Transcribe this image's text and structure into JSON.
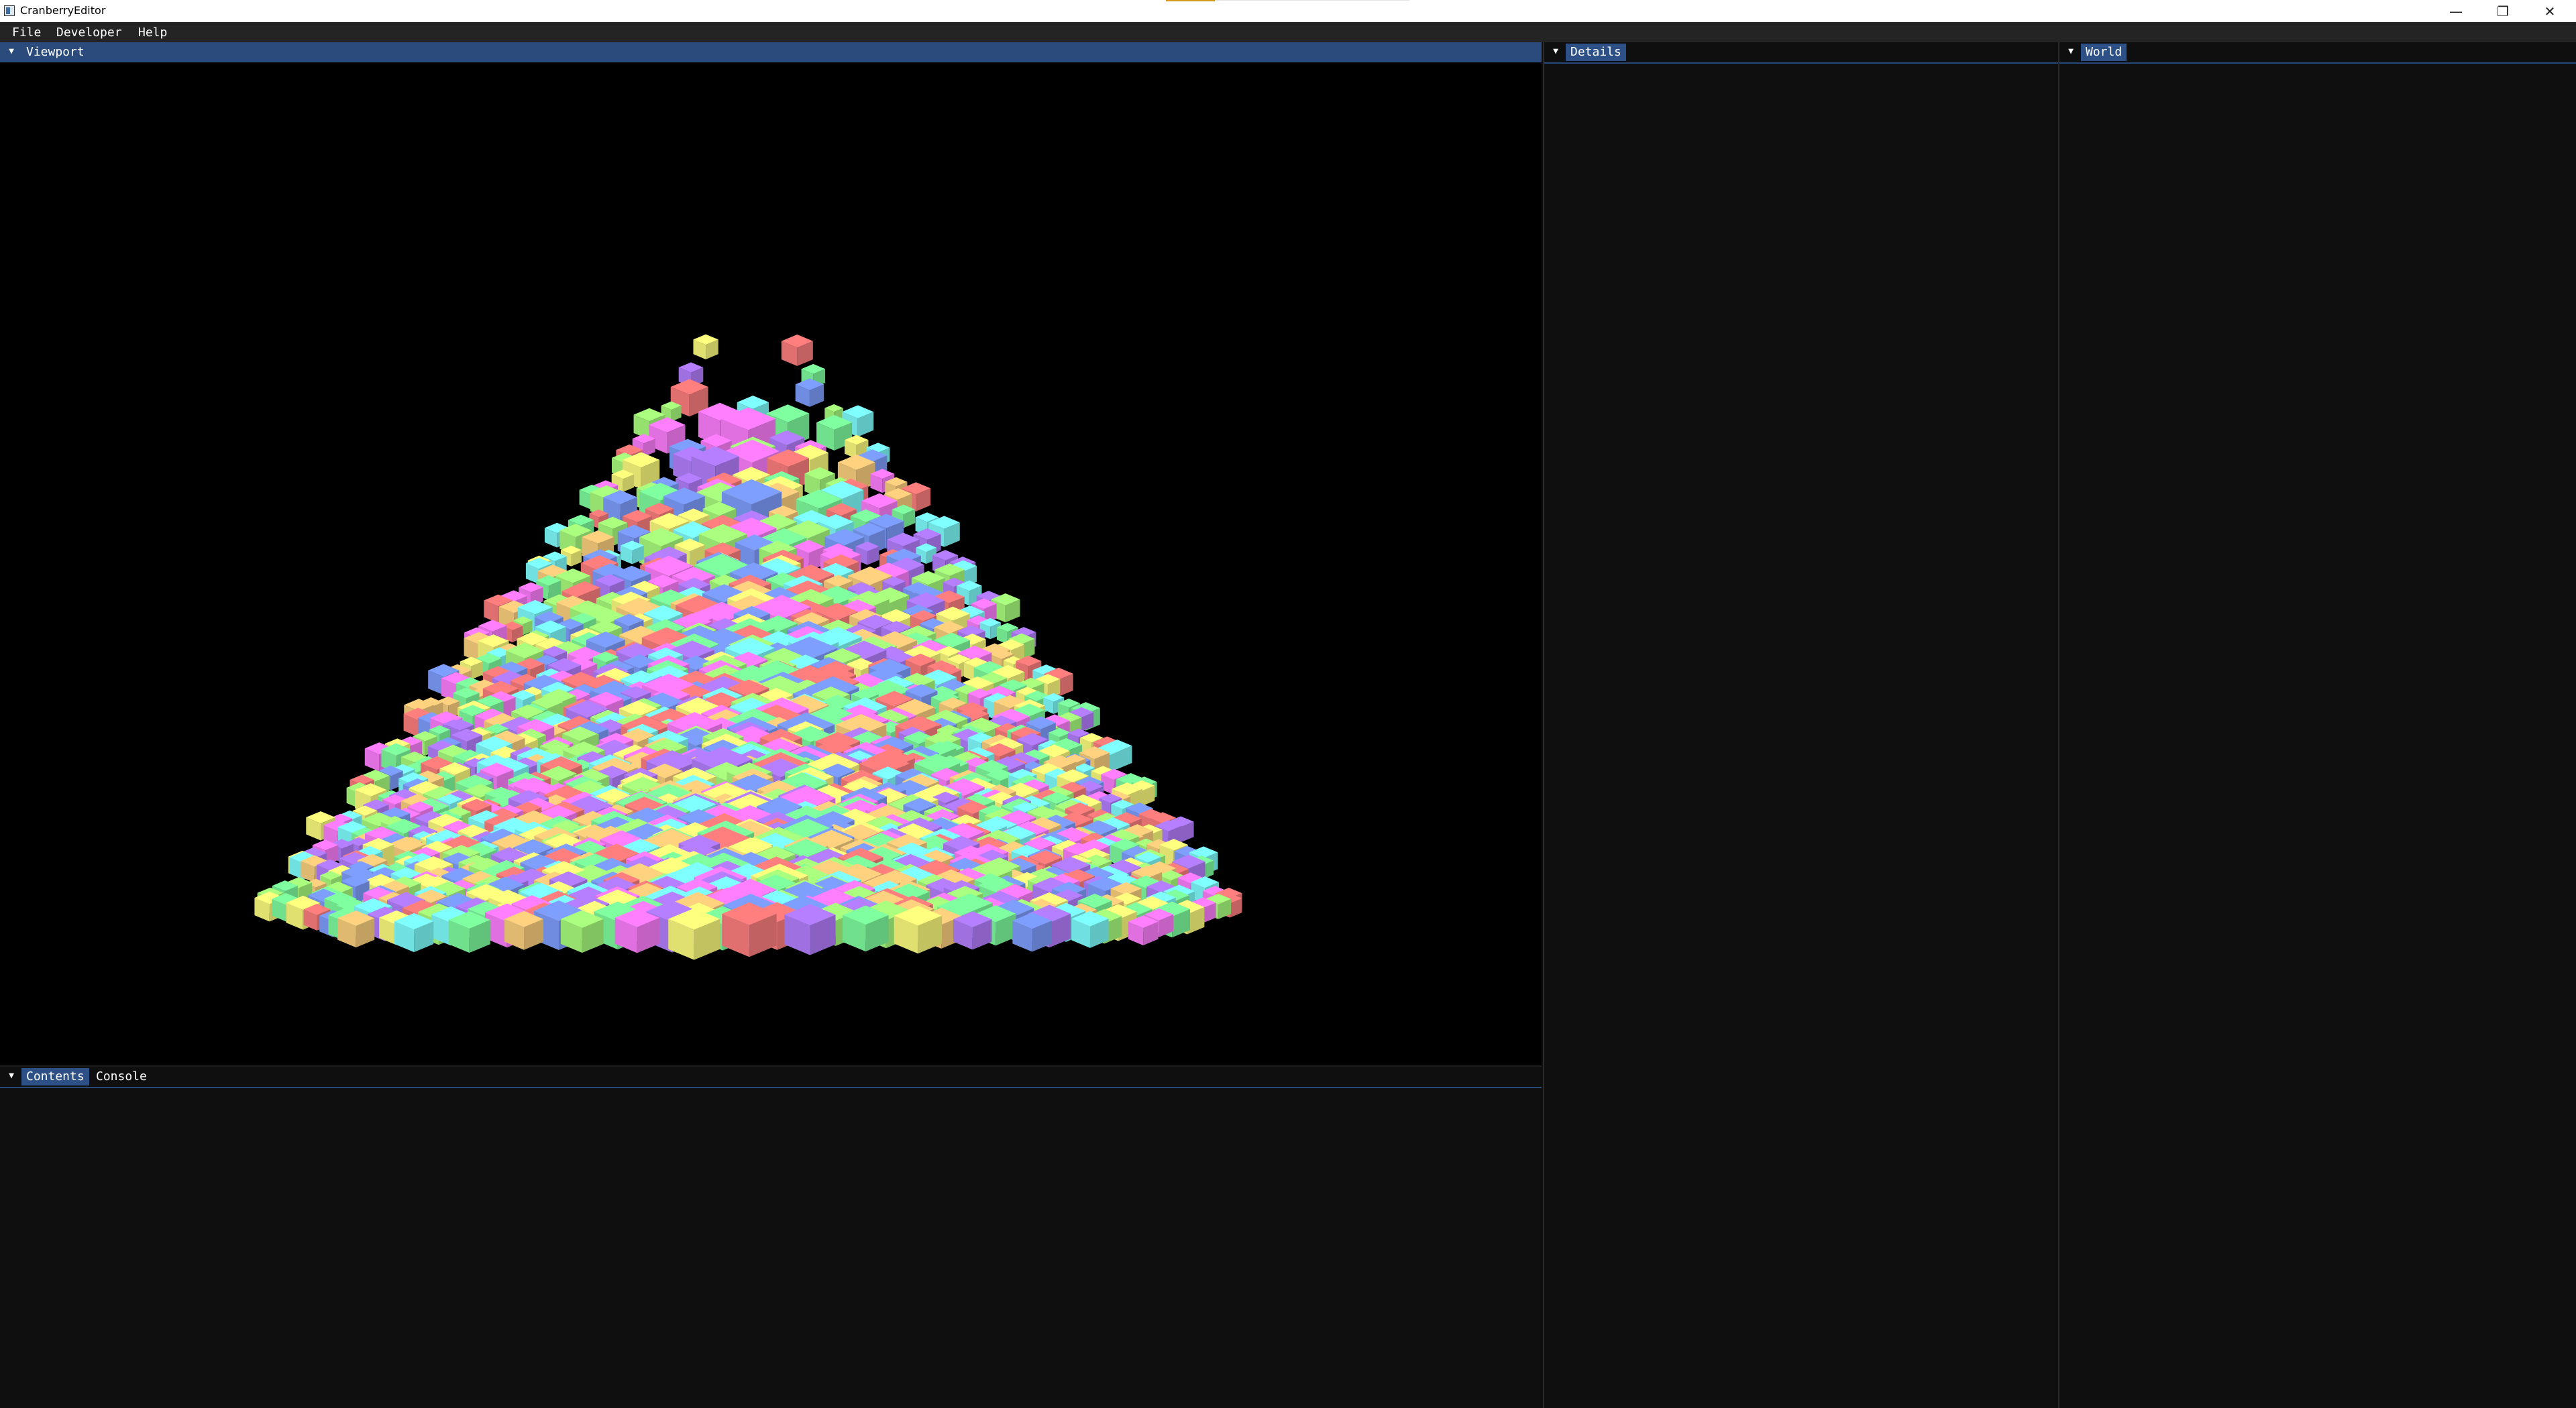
{
  "window": {
    "title": "CranberryEditor",
    "controls": {
      "minimize": "—",
      "maximize": "❐",
      "close": "✕"
    }
  },
  "menu": {
    "items": [
      "File",
      "Developer",
      "Help"
    ]
  },
  "panels": {
    "viewport": {
      "tab": "Viewport"
    },
    "contents": {
      "tabs": [
        "Contents",
        "Console"
      ]
    },
    "details": {
      "tab": "Details"
    },
    "world": {
      "tab": "World"
    }
  },
  "icons": {
    "collapse": "collapse-triangle-icon",
    "app": "app-icon"
  },
  "colors": {
    "accent": "#2a4b7c",
    "panel_bg": "#0f0f0f",
    "menubar_bg": "#242424",
    "cube_palette": [
      "#ff7f7f",
      "#ffd27f",
      "#ffff7f",
      "#aaff7f",
      "#7fff9f",
      "#7fffff",
      "#7f9fff",
      "#b57fff",
      "#ff7fff"
    ]
  }
}
